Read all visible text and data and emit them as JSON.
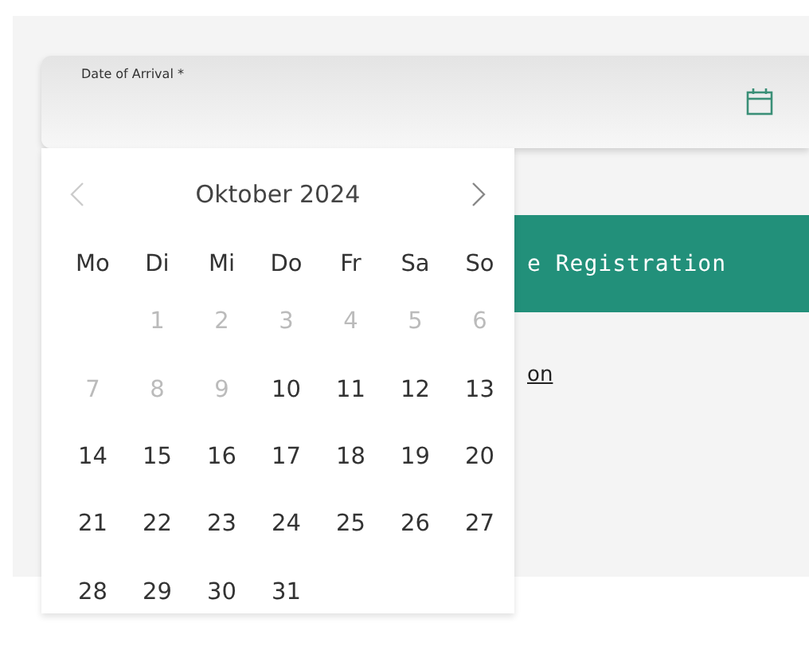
{
  "field": {
    "label": "Date of Arrival *"
  },
  "calendar": {
    "month": "Oktober 2024",
    "prev": {
      "disabled": true
    },
    "next": {
      "disabled": false
    },
    "weekdays": [
      "Mo",
      "Di",
      "Mi",
      "Do",
      "Fr",
      "Sa",
      "So"
    ],
    "days": [
      {
        "label": "1",
        "disabled": true
      },
      {
        "label": "2",
        "disabled": true
      },
      {
        "label": "3",
        "disabled": true
      },
      {
        "label": "4",
        "disabled": true
      },
      {
        "label": "5",
        "disabled": true
      },
      {
        "label": "6",
        "disabled": true
      },
      {
        "label": "7",
        "disabled": true
      },
      {
        "label": "8",
        "disabled": true
      },
      {
        "label": "9",
        "disabled": true
      },
      {
        "label": "10",
        "disabled": false
      },
      {
        "label": "11",
        "disabled": false
      },
      {
        "label": "12",
        "disabled": false
      },
      {
        "label": "13",
        "disabled": false
      },
      {
        "label": "14",
        "disabled": false
      },
      {
        "label": "15",
        "disabled": false
      },
      {
        "label": "16",
        "disabled": false
      },
      {
        "label": "17",
        "disabled": false
      },
      {
        "label": "18",
        "disabled": false
      },
      {
        "label": "19",
        "disabled": false
      },
      {
        "label": "20",
        "disabled": false
      },
      {
        "label": "21",
        "disabled": false
      },
      {
        "label": "22",
        "disabled": false
      },
      {
        "label": "23",
        "disabled": false
      },
      {
        "label": "24",
        "disabled": false
      },
      {
        "label": "25",
        "disabled": false
      },
      {
        "label": "26",
        "disabled": false
      },
      {
        "label": "27",
        "disabled": false
      },
      {
        "label": "28",
        "disabled": false
      },
      {
        "label": "29",
        "disabled": false
      },
      {
        "label": "30",
        "disabled": false
      },
      {
        "label": "31",
        "disabled": false
      }
    ]
  },
  "button": {
    "label": "e Registration"
  },
  "link": {
    "label": "on"
  }
}
